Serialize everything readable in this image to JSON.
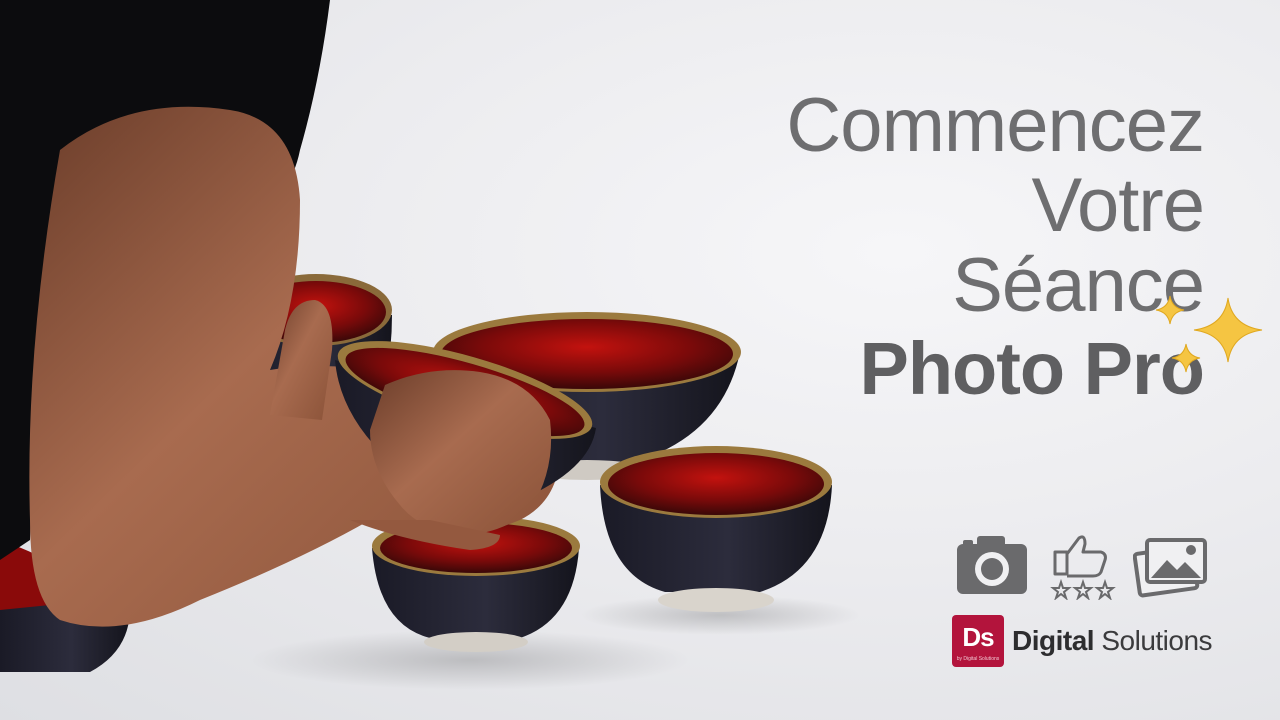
{
  "headline": {
    "line1": "Commencez",
    "line2": "Votre",
    "line3": "Séance",
    "line4": "Photo Pro"
  },
  "icons": [
    "camera-icon",
    "thumbs-up-rating-icon",
    "photo-gallery-icon"
  ],
  "brand": {
    "logo_text": "Ds",
    "logo_small": "by Digital Solutions",
    "name_bold": "Digital",
    "name_light": "Solutions",
    "color": "#b3143c"
  },
  "colors": {
    "headline": "#6e6e70",
    "sparkle": "#f5c542",
    "background": "#ececee"
  }
}
